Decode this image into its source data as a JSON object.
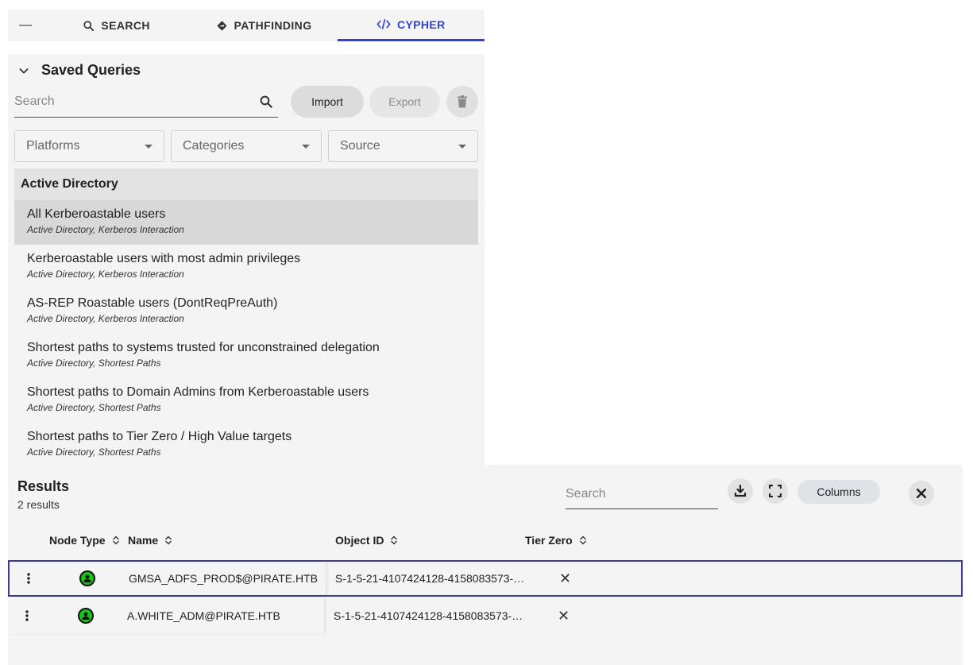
{
  "tabs": {
    "collapse_glyph": "—",
    "items": [
      {
        "label": "SEARCH",
        "icon": "search-icon"
      },
      {
        "label": "PATHFINDING",
        "icon": "diamond-route-icon"
      },
      {
        "label": "CYPHER",
        "icon": "code-icon",
        "active": true
      }
    ],
    "accent": "#2f43d8"
  },
  "saved_queries": {
    "title": "Saved Queries",
    "search_placeholder": "Search",
    "import_label": "Import",
    "export_label": "Export",
    "filters": [
      "Platforms",
      "Categories",
      "Source"
    ],
    "group": "Active Directory",
    "items": [
      {
        "title": "All Kerberoastable users",
        "sub": "Active Directory, Kerberos Interaction",
        "selected": true
      },
      {
        "title": "Kerberoastable users with most admin privileges",
        "sub": "Active Directory, Kerberos Interaction"
      },
      {
        "title": "AS-REP Roastable users (DontReqPreAuth)",
        "sub": "Active Directory, Kerberos Interaction"
      },
      {
        "title": "Shortest paths to systems trusted for unconstrained delegation",
        "sub": "Active Directory, Shortest Paths"
      },
      {
        "title": "Shortest paths to Domain Admins from Kerberoastable users",
        "sub": "Active Directory, Shortest Paths"
      },
      {
        "title": "Shortest paths to Tier Zero / High Value targets",
        "sub": "Active Directory, Shortest Paths"
      }
    ]
  },
  "results": {
    "title": "Results",
    "count": "2 results",
    "search_placeholder": "Search",
    "columns_label": "Columns",
    "headers": [
      "Node Type",
      "Name",
      "Object ID",
      "Tier Zero"
    ],
    "rows": [
      {
        "name": "GMSA_ADFS_PROD$@PIRATE.HTB",
        "object_id": "S-1-5-21-4107424128-4158083573-…",
        "tier_zero": "✕"
      },
      {
        "name": "A.WHITE_ADM@PIRATE.HTB",
        "object_id": "S-1-5-21-4107424128-4158083573-…",
        "tier_zero": "✕"
      }
    ],
    "node_color": "#19c219"
  }
}
